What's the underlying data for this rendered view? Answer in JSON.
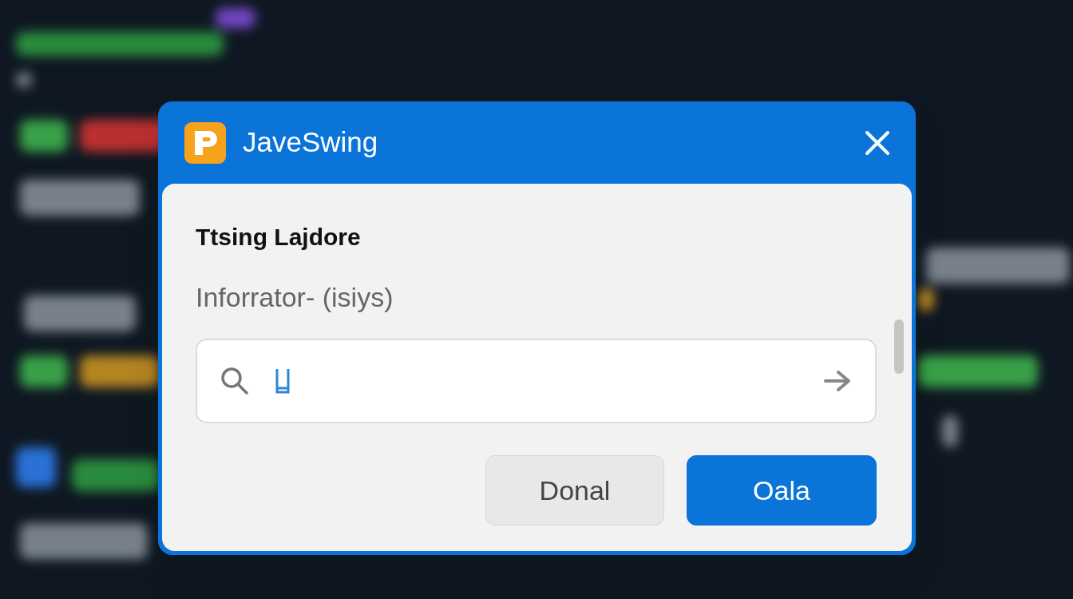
{
  "window": {
    "title": "JaveSwing"
  },
  "heading": "Ttsing Lajdore",
  "subtitle": "Inforrator- (isiys)",
  "buttons": [
    {
      "label": "Donal",
      "kind": "secondary"
    },
    {
      "label": "Oala",
      "kind": "primary"
    }
  ]
}
